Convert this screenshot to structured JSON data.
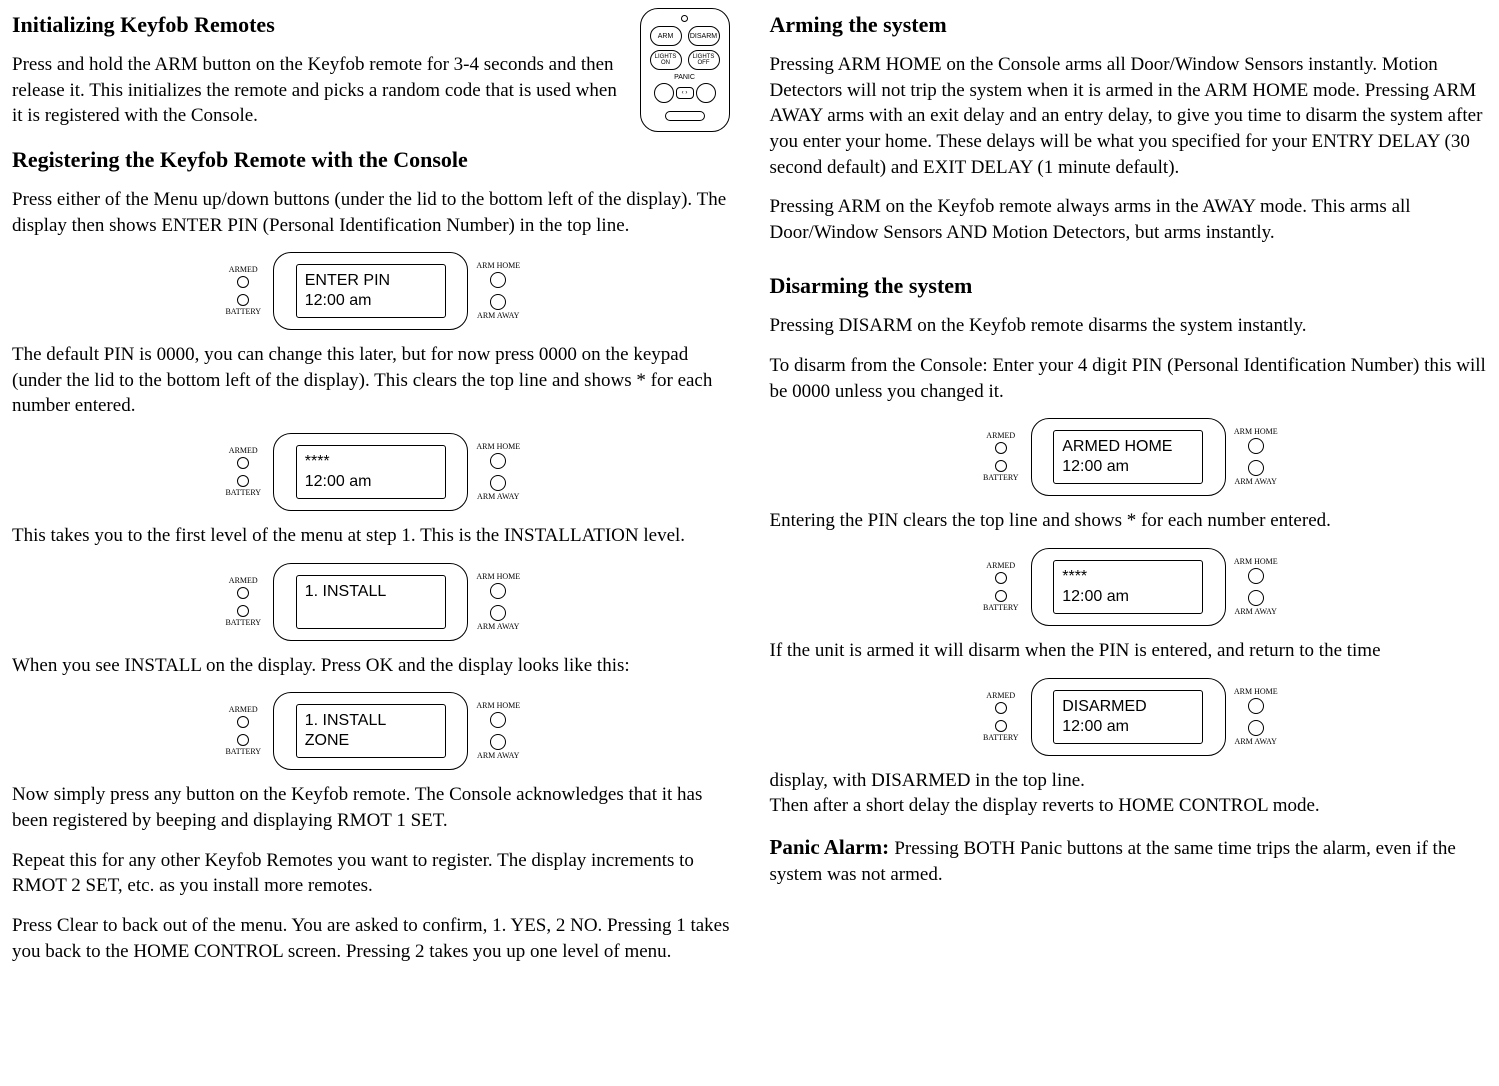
{
  "left": {
    "h1": "Initializing Keyfob Remotes",
    "p1": "Press and hold  the ARM button on the Keyfob remote for 3-4 seconds and then release it. This initializes the remote and picks a random code that is used when it is registered with the Console.",
    "h2": "Registering the Keyfob Remote with the Console",
    "p2": "Press either of the Menu up/down buttons (under the lid to the bottom left of the display). The display then shows ENTER PIN (Personal Identification Number) in the top line.",
    "screen_enter_pin": {
      "l1": "ENTER PIN",
      "l2": "12:00 am"
    },
    "p3": "The default PIN is 0000, you can change this later, but for now press 0000 on the keypad (under the lid to the bottom left of the display). This clears the top line and shows * for each number entered.",
    "screen_stars": {
      "l1": "****",
      "l2": "12:00 am"
    },
    "p4": "This takes you to the first level of the menu at step 1. This is the INSTALLATION level.",
    "screen_install": {
      "l1": "1. INSTALL",
      "l2": ""
    },
    "p5": "When you see INSTALL on the display. Press OK and the display looks like this:",
    "screen_install_zone": {
      "l1": "1. INSTALL",
      "l2": "ZONE"
    },
    "p6": "Now simply press any button on the Keyfob remote. The Console acknowledges that it has been registered by beeping and displaying RMOT  1 SET.",
    "p7": "Repeat this for any other Keyfob Remotes you want to register.  The display increments to RMOT  2 SET, etc. as you install more remotes.",
    "p8": "Press Clear to back out of the menu. You are asked to confirm,  1. YES, 2 NO. Pressing 1 takes you back to the HOME CONTROL screen. Pressing 2 takes you up one level of menu."
  },
  "right": {
    "h1": "Arming the system",
    "p1": "Pressing ARM HOME on the Console arms all Door/Window Sensors instantly. Motion Detectors will not trip the system when it is armed in the ARM HOME mode. Pressing ARM AWAY arms with an exit delay and an entry delay, to give you time to disarm the system after you enter your home. These delays will be what you specified for your ENTRY DELAY (30 second default) and EXIT DELAY (1 minute default).",
    "p2": "Pressing ARM on the Keyfob remote always arms in the AWAY mode. This arms all Door/Window Sensors AND Motion Detectors, but arms instantly.",
    "h2": "Disarming the system",
    "p3": "Pressing DISARM on the Keyfob remote disarms the system instantly.",
    "p4": "To disarm from the Console: Enter your 4 digit  PIN (Personal Identification Number) this will be 0000 unless you changed it.",
    "screen_armed_home": {
      "l1": "ARMED HOME",
      "l2": "12:00 am"
    },
    "p5": "Entering the PIN clears the top line and shows * for each number entered.",
    "screen_stars": {
      "l1": "****",
      "l2": "12:00 am"
    },
    "p6": "If the unit is armed  it will disarm when the PIN is entered, and return to the time",
    "screen_disarmed": {
      "l1": "DISARMED",
      "l2": "12:00 am"
    },
    "p7": "display, with DISARMED in the top line.",
    "p8": "Then after a short delay the display reverts to HOME CONTROL mode.",
    "panic_label": "Panic Alarm: ",
    "p9": "Pressing BOTH Panic buttons at the same time trips the alarm, even if the system was not armed."
  },
  "console_labels": {
    "armed": "ARMED",
    "battery": "BATTERY",
    "arm_home": "ARM HOME",
    "arm_away": "ARM AWAY"
  },
  "remote": {
    "arm": "ARM",
    "disarm": "DISARM",
    "lights_on": "LIGHTS ON",
    "lights_off": "LIGHTS OFF",
    "panic": "PANIC",
    "arrow_left": "‹",
    "arrow_right": "›"
  }
}
